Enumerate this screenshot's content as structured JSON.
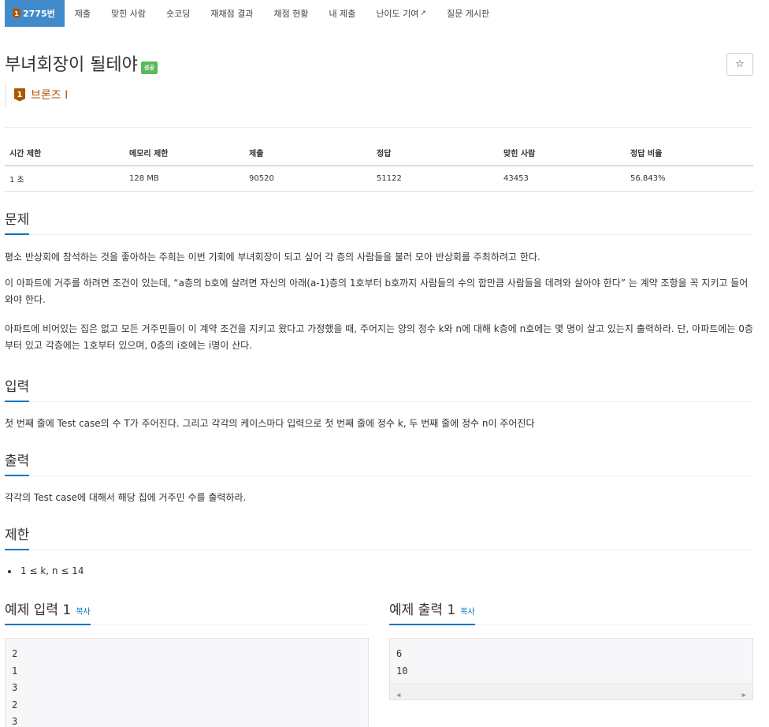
{
  "nav": {
    "problem_number": "2775번",
    "tier_digit": "1",
    "items": [
      "제출",
      "맞힌 사람",
      "숏코딩",
      "재채점 결과",
      "채점 현황",
      "내 제출",
      "난이도 기여",
      "질문 게시판"
    ]
  },
  "problem": {
    "title": "부녀회장이 될테야",
    "status_badge": "성공",
    "star_symbol": "☆",
    "tier_digit": "1",
    "tier_label": "브론즈 I"
  },
  "info": {
    "headers": [
      "시간 제한",
      "메모리 제한",
      "제출",
      "정답",
      "맞힌 사람",
      "정답 비율"
    ],
    "values": [
      "1 초",
      "128 MB",
      "90520",
      "51122",
      "43453",
      "56.843%"
    ]
  },
  "sections": {
    "description": {
      "heading": "문제",
      "paragraphs": [
        "평소 반상회에 참석하는 것을 좋아하는 주희는 이번 기회에 부녀회장이 되고 싶어 각 층의 사람들을 불러 모아 반상회를 주최하려고 한다.",
        "이 아파트에 거주를 하려면 조건이 있는데, “a층의 b호에 살려면 자신의 아래(a-1)층의 1호부터 b호까지 사람들의 수의 합만큼 사람들을 데려와 살아야 한다” 는 계약 조항을 꼭 지키고 들어와야 한다.",
        "아파트에 비어있는 집은 없고 모든 거주민들이 이 계약 조건을 지키고 왔다고 가정했을 때, 주어지는 양의 정수 k와 n에 대해 k층에 n호에는 몇 명이 살고 있는지 출력하라. 단, 아파트에는 0층부터 있고 각층에는 1호부터 있으며, 0층의 i호에는 i명이 산다."
      ]
    },
    "input": {
      "heading": "입력",
      "text": "첫 번째 줄에 Test case의 수 T가 주어진다. 그리고 각각의 케이스마다 입력으로 첫 번째 줄에 정수 k, 두 번째 줄에 정수 n이 주어진다"
    },
    "output": {
      "heading": "출력",
      "text": "각각의 Test case에 대해서 해당 집에 거주민 수를 출력하라."
    },
    "limits": {
      "heading": "제한",
      "items": [
        "1 ≤ k, n ≤ 14"
      ]
    }
  },
  "samples": {
    "input": {
      "heading": "예제 입력 1",
      "copy_label": "복사",
      "lines": [
        "2",
        "1",
        "3",
        "2",
        "3"
      ]
    },
    "output": {
      "heading": "예제 출력 1",
      "copy_label": "복사",
      "lines": [
        "6",
        "10"
      ]
    }
  },
  "colors": {
    "nav_active": "#428bca",
    "accent": "#0076c0",
    "success": "#5cb85c",
    "bronze": "#ad5600"
  }
}
